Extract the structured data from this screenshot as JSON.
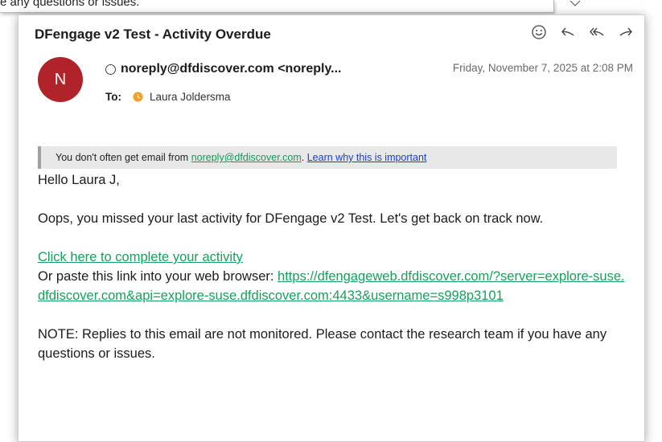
{
  "background_window": {
    "snippet": "e any questions or issues."
  },
  "email": {
    "subject": "DFengage v2 Test - Activity Overdue",
    "avatar_initial": "N",
    "sender": "noreply@dfdiscover.com <noreply...",
    "date": "Friday, November 7, 2025 at 2:08 PM",
    "to_label": "To:",
    "recipient": "Laura Joldersma",
    "banner": {
      "prefix": "You don't often get email from ",
      "email_link": "noreply@dfdiscover.com",
      "separator": ". ",
      "learn_link": "Learn why this is important"
    },
    "greeting": "Hello Laura J,",
    "paragraph1": "Oops, you missed your last activity for DFengage v2 Test. Let's get back on track now.",
    "activity_link": "Click here to complete your activity",
    "paste_text": "Or paste this link into your web browser: ",
    "url": "https://dfengageweb.dfdiscover.com/?server=explore-suse.dfdiscover.com&api=explore-suse.dfdiscover.com:4433&username=s998p3101",
    "note": "NOTE: Replies to this email are not monitored. Please contact the research team if you have any questions or issues."
  },
  "toolbar": {
    "icons": [
      "emoji-icon",
      "reply-icon",
      "reply-all-icon",
      "forward-icon"
    ]
  },
  "colors": {
    "avatar": "#b0232a",
    "link_green": "#17a05d",
    "link_blue": "#1a3fcc",
    "clock_orange": "#f0a030"
  }
}
